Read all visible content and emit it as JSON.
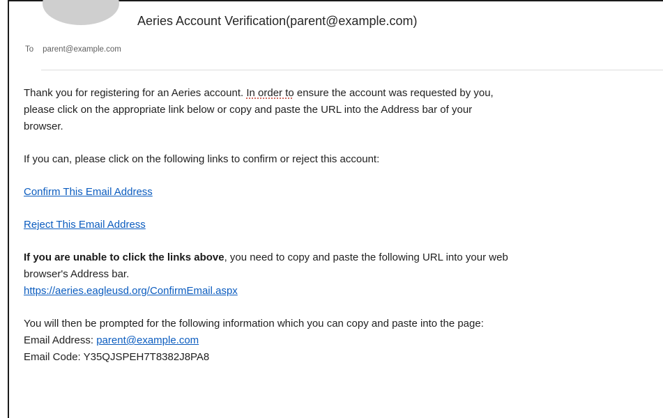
{
  "email": {
    "subject": "Aeries Account Verification(parent@example.com)",
    "to_label": "To",
    "to_address": "parent@example.com"
  },
  "body": {
    "para1_line1_pre": "Thank you for registering for an Aeries account. ",
    "para1_line1_flag": "In order to",
    "para1_line1_post": " ensure the account was requested by you,",
    "para1_line2": "please click on the appropriate link below or copy and paste the URL into the Address bar of your",
    "para1_line3": "browser.",
    "para2": "If you can, please click on the following links to confirm or reject this account:",
    "confirm_link": "Confirm This Email Address",
    "reject_link": "Reject This Email Address",
    "para3_bold": "If you are unable to click the links above",
    "para3_rest": ", you need to copy and paste the following URL into your web",
    "para3_line2": "browser's Address bar.",
    "url_link": "https://aeries.eagleusd.org/ConfirmEmail.aspx",
    "para4": "You will then be prompted for the following information which you can copy and paste into the page:",
    "email_address_label": "Email Address: ",
    "email_address_value": "parent@example.com",
    "email_code_label": "Email Code: ",
    "email_code_value": "Y35QJSPEH7T8382J8PA8"
  },
  "colors": {
    "link": "#0b5cbf",
    "avatar": "#cfcfcf",
    "separator": "#dddddd"
  }
}
